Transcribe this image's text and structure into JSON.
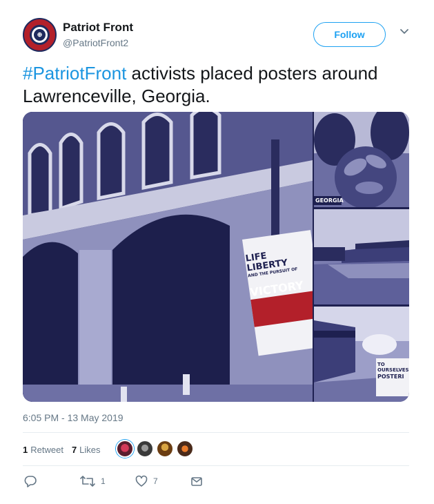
{
  "tweet": {
    "author_name": "Patriot Front",
    "author_handle": "@PatriotFront2",
    "follow_label": "Follow",
    "text_hashtag": "#PatriotFront",
    "text_body": " activists placed posters around Lawrenceville, Georgia.",
    "timestamp": "6:05 PM - 13 May 2019",
    "retweet_count": "1",
    "retweet_label": "Retweet",
    "like_count": "7",
    "like_label": "Likes",
    "action_retweet_count": "1",
    "action_like_count": "7"
  },
  "media": {
    "main_poster": {
      "line1": "LIFE",
      "line2": "LIBERTY",
      "line3": "AND THE PURSUIT OF",
      "line4": "VICTORY"
    },
    "side1_label": "GEORGIA",
    "side3_label_line1": "TO OURSELVES",
    "side3_label_line2": "POSTERI"
  },
  "colors": {
    "accent": "#1da1f2",
    "hashtag": "#1b95e0",
    "muted": "#657786",
    "text": "#14171a",
    "image_tint": "#2d2f6a"
  },
  "icons": [
    "reply-icon",
    "retweet-icon",
    "like-icon",
    "share-icon",
    "chevron-down-icon"
  ]
}
